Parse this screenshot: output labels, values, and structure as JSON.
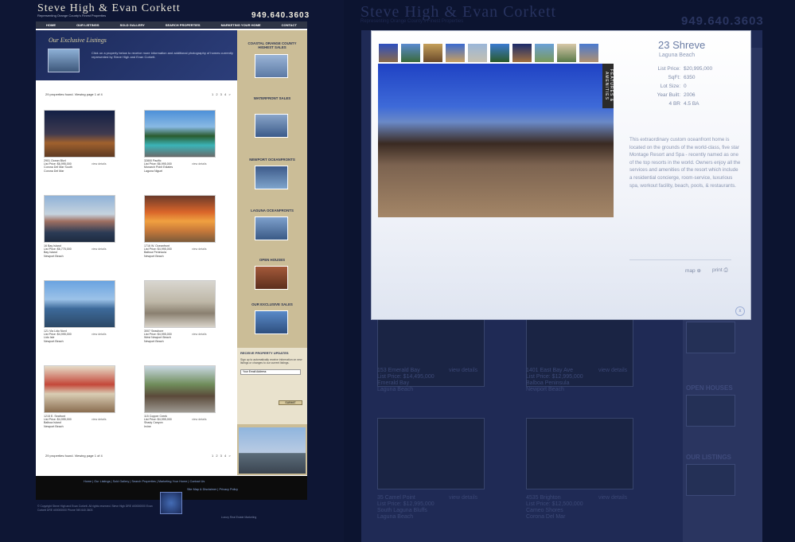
{
  "header": {
    "brand": "Steve High & Evan Corkett",
    "subtitle": "Representing Orange County's Finest Properties",
    "phone": "949.640.3603",
    "nav": [
      "HOME",
      "OUR LISTINGS",
      "SOLD GALLERY",
      "SEARCH PROPERTIES",
      "MARKETING YOUR HOME",
      "CONTACT"
    ]
  },
  "banner": {
    "title": "Our Exclusive Listings",
    "text": "Click on a property below to receive more information and additional photography of homes currently represented by Steve High and Evan Corkett."
  },
  "results": {
    "found_top": "29 properties found. Viewing page 1 of 4",
    "found_bottom": "29 properties found. Viewing page 1 of 4",
    "pager": "1 2 3 4 >"
  },
  "listings": [
    {
      "line1": "2901 Ocean Blvd",
      "line2": "List Price: $6,995,000",
      "line3": "Corona Del Mar South",
      "line4": "Corona Del Mar",
      "view": "view details"
    },
    {
      "line1": "32800 Pacific",
      "line2": "List Price: $6,995,000",
      "line3": "Monarch Point Estates",
      "line4": "Laguna Niguel",
      "view": "view details"
    },
    {
      "line1": "16 Bay Island",
      "line2": "List Price: $6,775,000",
      "line3": "Bay Island",
      "line4": "Newport Beach",
      "view": "view details"
    },
    {
      "line1": "1716 W. Oceanfront",
      "line2": "List Price: $4,995,000",
      "line3": "Balboa Peninsula",
      "line4": "Newport Beach",
      "view": "view details"
    },
    {
      "line1": "121 Via Lido Nord",
      "line2": "List Price: $4,995,000",
      "line3": "Lido Isle",
      "line4": "Newport Beach",
      "view": "view details"
    },
    {
      "line1": "3007 Seashore",
      "line2": "List Price: $4,995,000",
      "line3": "West Newport Beach",
      "line4": "Newport Beach",
      "view": "view details"
    },
    {
      "line1": "1215 E. Seafront",
      "line2": "List Price: $4,995,000",
      "line3": "Balboa Island",
      "line4": "Newport Beach",
      "view": "view details"
    },
    {
      "line1": "115 Copper Creek",
      "line2": "List Price: $4,995,000",
      "line3": "Shady Canyon",
      "line4": "Irvine",
      "view": "view details"
    }
  ],
  "sidebar": {
    "sections": [
      "COASTAL ORANGE COUNTY HIGHEST SALES",
      "WATERFRONT SALES",
      "NEWPORT OCEANFRONTS",
      "LAGUNA OCEANFRONTS",
      "OPEN HOUSES",
      "OUR EXCLUSIVE SALES"
    ],
    "signup_title": "RECEIVE PROPERTY UPDATES",
    "signup_text": "Sign up to automatically receive information on new listings or changes to our current listings.",
    "signup_placeholder": "Your Email Address",
    "signup_button": "SUBMIT"
  },
  "footer": {
    "links": "Home | Our Listings | Sold Gallery | Search Properties | Marketing Your Home | Contact Us",
    "links2": "Site Map & Disclaimer | Privacy Policy",
    "copyright": "© Copyright Steve High and Evan Corkett. All rights reserved. Steve High DRE #00000000 Evan Corkett DRE #00000000 Phone 949.640.3603",
    "designed_by": "Luxury Real Estate Marketing"
  },
  "background_page": {
    "brand": "Steve High & Evan Corkett",
    "subtitle": "Representing Orange County's Finest Properties",
    "phone": "949.640.3603",
    "cards": [
      {
        "line1": "153 Emerald Bay",
        "line2": "List Price: $14,495,000",
        "line3": "Emerald Bay",
        "line4": "Laguna Beach",
        "view": "view details"
      },
      {
        "line1": "1401 East Bay Ave",
        "line2": "List Price: $12,995,000",
        "line3": "Balboa Peninsula",
        "line4": "Newport Beach",
        "view": "view details"
      },
      {
        "line1": "35 Camel Point",
        "line2": "List Price: $12,995,000",
        "line3": "South Laguna Bluffs",
        "line4": "Laguna Beach",
        "view": "view details"
      },
      {
        "line1": "4535 Brighton",
        "line2": "List Price: $12,500,000",
        "line3": "Cameo Shores",
        "line4": "Corona Del Mar",
        "view": "view details"
      }
    ],
    "side": [
      "OPEN HOUSES",
      "OUR LISTINGS"
    ]
  },
  "modal": {
    "title": "23 Shreve",
    "city": "Laguna Beach",
    "ribbon": "FEATURES & AMENITIES",
    "specs": [
      {
        "k": "List Price:",
        "v": "$20,995,000"
      },
      {
        "k": "SqFt:",
        "v": "6350"
      },
      {
        "k": "Lot Size:",
        "v": "0"
      },
      {
        "k": "Year Built:",
        "v": "2006"
      },
      {
        "k": "4 BR",
        "v": "4.5 BA"
      }
    ],
    "description": "This extraordinary custom oceanfront home is located on the grounds of the world-class, five star Montage Resort and Spa - recently named as one of the top resorts in the world.  Owners enjoy all the services and amenities of the resort which include a residential concierge, room-service, luxurious spa, workout facility, beach, pools, & restaurants.",
    "map_label": "map",
    "print_label": "print",
    "close_label": "x"
  }
}
